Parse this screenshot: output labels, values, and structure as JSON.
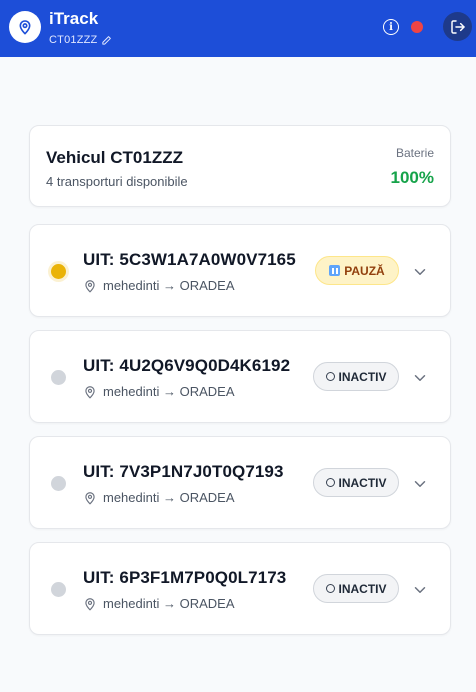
{
  "header": {
    "title": "iTrack",
    "plate": "CT01ZZZ",
    "info_icon": "i",
    "status_color": "#ef4444"
  },
  "vehicle": {
    "title": "Vehicul CT01ZZZ",
    "subtitle": "4 transporturi disponibile",
    "battery_label": "Baterie",
    "battery_value": "100%"
  },
  "transports": [
    {
      "uit": "UIT: 5C3W1A7A0W0V7165",
      "route": "mehedinti → ORADEA",
      "status": "PAUZĂ",
      "state": "pause"
    },
    {
      "uit": "UIT: 4U2Q6V9Q0D4K6192",
      "route": "mehedinti → ORADEA",
      "status": "INACTIV",
      "state": "inactive"
    },
    {
      "uit": "UIT: 7V3P1N7J0T0Q7193",
      "route": "mehedinti → ORADEA",
      "status": "INACTIV",
      "state": "inactive"
    },
    {
      "uit": "UIT: 6P3F1M7P0Q0L7173",
      "route": "mehedinti → ORADEA",
      "status": "INACTIV",
      "state": "inactive"
    }
  ],
  "colors": {
    "header": "#1d4ed8",
    "battery": "#16a34a",
    "pause": "#eab308",
    "inactive": "#d1d5db"
  }
}
